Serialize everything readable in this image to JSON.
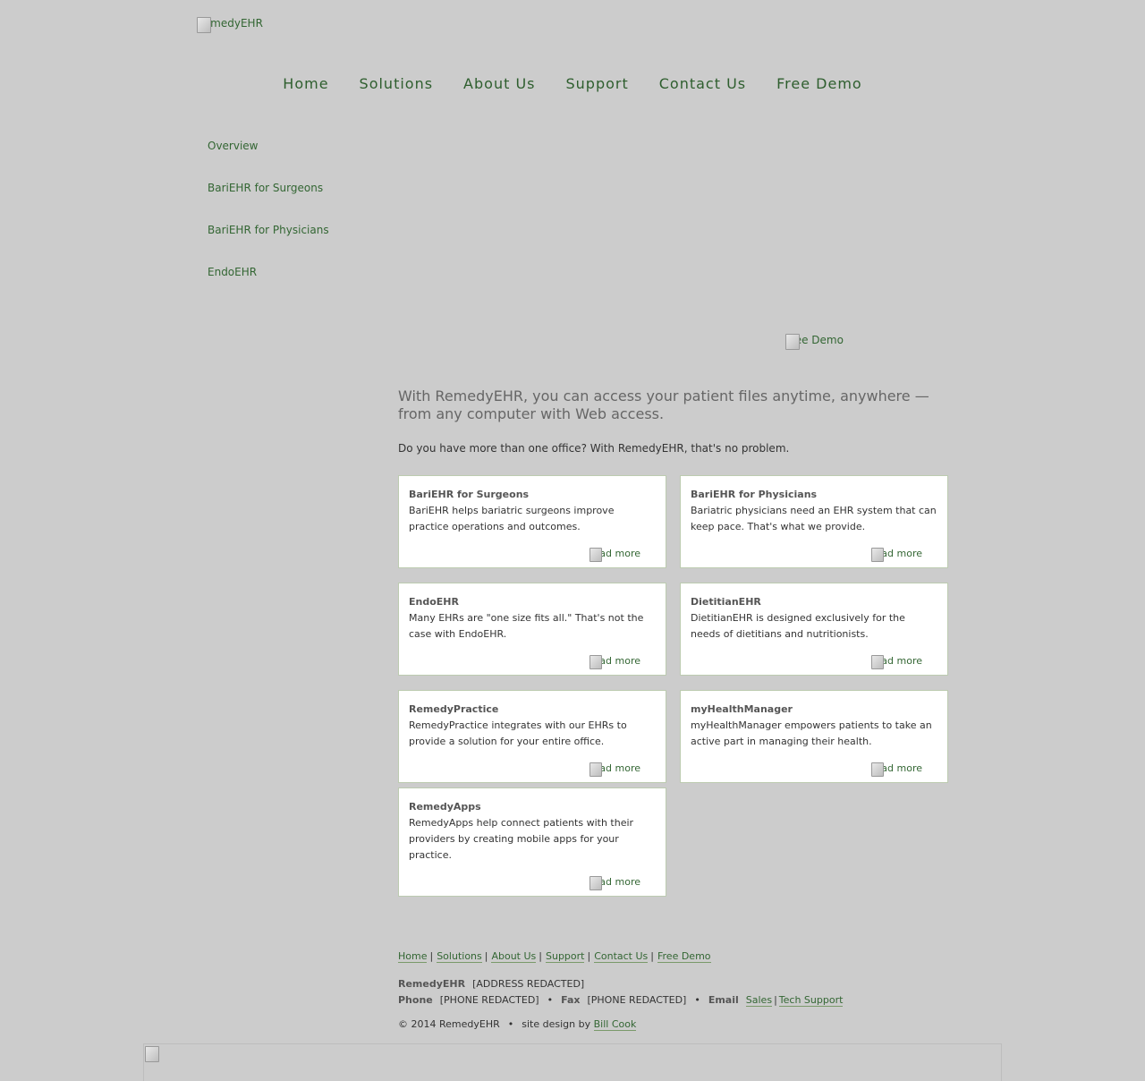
{
  "logo": {
    "alt": "RemedyEHR"
  },
  "top_nav": [
    "Home",
    "Solutions",
    "About Us",
    "Support",
    "Contact Us",
    "Free Demo"
  ],
  "side_nav": [
    "Overview",
    "BariEHR for Surgeons",
    "BariEHR for Physicians",
    "EndoEHR"
  ],
  "demo_banner": {
    "alt": "Free Demo"
  },
  "main": {
    "lead": "With RemedyEHR, you can access your patient files anytime, anywhere — from any computer with Web access.",
    "intro": "Do you have more than one office? With RemedyEHR, that's no problem."
  },
  "cards": [
    {
      "title": "BariEHR for Surgeons",
      "text": "BariEHR helps bariatric surgeons improve practice operations and outcomes.",
      "more": "read more"
    },
    {
      "title": "BariEHR for Physicians",
      "text": "Bariatric physicians need an EHR system that can keep pace. That's what we provide.",
      "more": "read more"
    },
    {
      "title": "EndoEHR",
      "text": "Many EHRs are \"one size fits all.\" That's not the case with EndoEHR.",
      "more": "read more"
    },
    {
      "title": "DietitianEHR",
      "text": "DietitianEHR is designed exclusively for the needs of dietitians and nutritionists.",
      "more": "read more"
    },
    {
      "title": "RemedyPractice",
      "text": "RemedyPractice integrates with our EHRs to provide a solution for your entire office.",
      "more": "read more"
    },
    {
      "title": "myHealthManager",
      "text": "myHealthManager empowers patients to take an active part in managing their health.",
      "more": "read more"
    },
    {
      "title": "RemedyApps",
      "text": "RemedyApps help connect patients with their providers by creating mobile apps for your practice.",
      "more": "read more"
    }
  ],
  "footer": {
    "links": [
      "Home",
      "Solutions",
      "About Us",
      "Support",
      "Contact Us",
      "Free Demo"
    ],
    "separator": "|",
    "company": "RemedyEHR",
    "address": "[ADDRESS REDACTED]",
    "phone_label": "Phone",
    "phone": "[PHONE REDACTED]",
    "fax_label": "Fax",
    "fax": "[PHONE REDACTED]",
    "email_label": "Email",
    "email_sales": "Sales",
    "email_tech": "Tech Support",
    "bullet": "•",
    "copyright": "© 2014 RemedyEHR",
    "design_by": "site design by",
    "designer": "Bill Cook"
  },
  "colors": {
    "background": "#cccccc",
    "link": "#336633",
    "card_border": "#bccbb0"
  }
}
